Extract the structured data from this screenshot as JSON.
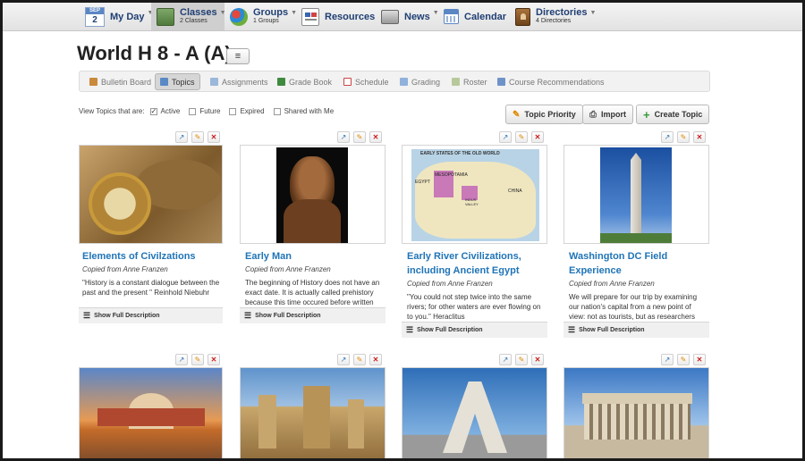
{
  "nav": {
    "myday": {
      "cal_month": "SEP",
      "cal_day": "2",
      "label": "My Day"
    },
    "classes": {
      "label": "Classes",
      "sub": "2 Classes"
    },
    "groups": {
      "label": "Groups",
      "sub": "1 Groups"
    },
    "resources": {
      "label": "Resources"
    },
    "news": {
      "label": "News"
    },
    "calendar": {
      "label": "Calendar"
    },
    "directories": {
      "label": "Directories",
      "sub": "4 Directories"
    }
  },
  "page": {
    "title": "World H 8 - A (A)"
  },
  "tabs": [
    {
      "label": "Bulletin Board"
    },
    {
      "label": "Topics"
    },
    {
      "label": "Assignments"
    },
    {
      "label": "Grade Book"
    },
    {
      "label": "Schedule"
    },
    {
      "label": "Grading"
    },
    {
      "label": "Roster"
    },
    {
      "label": "Course Recommendations"
    }
  ],
  "filters": {
    "label": "View Topics that are:",
    "options": [
      {
        "label": "Active",
        "checked": true
      },
      {
        "label": "Future",
        "checked": false
      },
      {
        "label": "Expired",
        "checked": false
      },
      {
        "label": "Shared with Me",
        "checked": false
      }
    ]
  },
  "actions": {
    "priority": "Topic Priority",
    "import": "Import",
    "create": "Create Topic"
  },
  "cards": [
    {
      "title": "Elements of Civilzations",
      "copied": "Copied from Anne Franzen",
      "desc": "\"History is a constant dialogue between the past and the present \" Reinhold Niebuhr",
      "more": "Show Full Description"
    },
    {
      "title": "Early Man",
      "copied": "Copied from Anne Franzen",
      "desc": "The beginning of History does not have an exact date.  It is actually called prehistory because this time occured before written",
      "more": "Show Full Description"
    },
    {
      "title": "Early River Civilizations, including Ancient Egypt",
      "copied": "Copied from Anne Franzen",
      "desc": "\"You could not step twice into the same rivers; for other waters are ever flowing on to you.\" Heraclitus",
      "more": "Show Full Description",
      "map_title": "EARLY STATES OF THE OLD WORLD",
      "map_labels": [
        "EGYPT",
        "MESOPOTAMIA",
        "INDUS VALLEY",
        "CHINA"
      ]
    },
    {
      "title": "Washington DC Field Experience",
      "copied": "Copied from Anne Franzen",
      "desc": "We will prepare for our trip by examining our nation's capital from a new point of view: not as tourists, but as researchers",
      "more": "Show Full Description"
    }
  ]
}
